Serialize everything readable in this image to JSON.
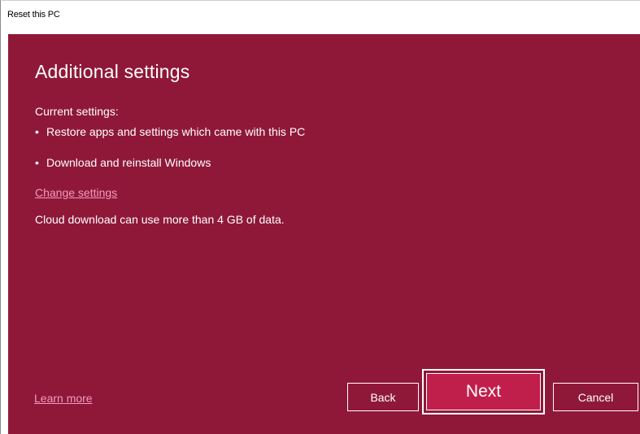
{
  "window": {
    "title": "Reset this PC"
  },
  "content": {
    "heading": "Additional settings",
    "current_settings_label": "Current settings:",
    "bullet_symbol": "•",
    "settings": [
      "Restore apps and settings which came with this PC",
      "Download and reinstall Windows"
    ],
    "change_settings_link": "Change settings",
    "data_notice": "Cloud download can use more than 4 GB of data.",
    "learn_more_link": "Learn more"
  },
  "buttons": {
    "back": "Back",
    "next": "Next",
    "cancel": "Cancel"
  },
  "colors": {
    "background": "#8f1838",
    "next_button": "#c11f4b",
    "link": "#f29bbd"
  }
}
